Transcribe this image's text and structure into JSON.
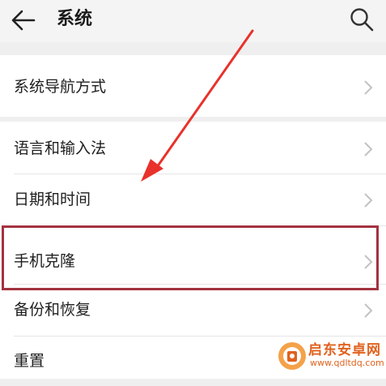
{
  "header": {
    "title": "系统"
  },
  "sections": [
    {
      "items": [
        {
          "label": "系统导航方式"
        }
      ]
    },
    {
      "items": [
        {
          "label": "语言和输入法"
        },
        {
          "label": "日期和时间"
        },
        {
          "label": "手机克隆"
        },
        {
          "label": "备份和恢复"
        },
        {
          "label": "重置"
        }
      ]
    }
  ],
  "annotation": {
    "highlight_color": "#a3323f",
    "arrow_color": "#e8322b"
  },
  "watermark": {
    "name": "启东安卓网",
    "url": "www.qdltdq.com"
  }
}
